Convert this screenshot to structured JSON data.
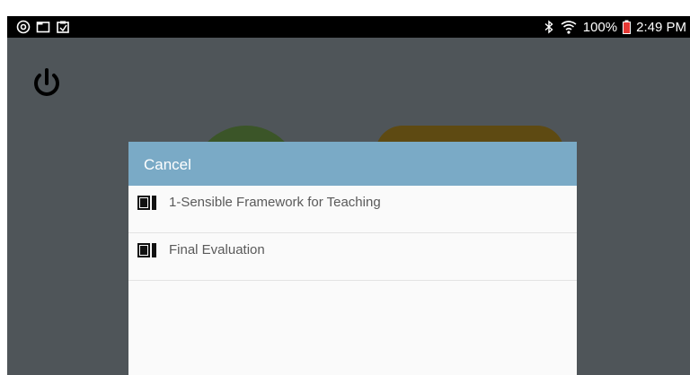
{
  "status_bar": {
    "left_icons": [
      "notification-icon",
      "folder-icon",
      "clipboard-icon"
    ],
    "bluetooth_icon": "bluetooth-icon",
    "wifi_icon": "wifi-icon",
    "battery_percent": "100%",
    "battery_icon": "battery-icon",
    "time": "2:49 PM"
  },
  "toolbar": {
    "power_icon": "power-icon"
  },
  "dialog": {
    "cancel_label": "Cancel",
    "items": [
      {
        "icon": "film-icon",
        "label": "1-Sensible Framework for Teaching"
      },
      {
        "icon": "film-icon",
        "label": "Final Evaluation"
      }
    ]
  },
  "colors": {
    "status_bar": "#000000",
    "background": "#4f5559",
    "dialog_header": "#7aaac6",
    "dialog_body": "#fafafa",
    "list_text": "#5a5a5a"
  }
}
